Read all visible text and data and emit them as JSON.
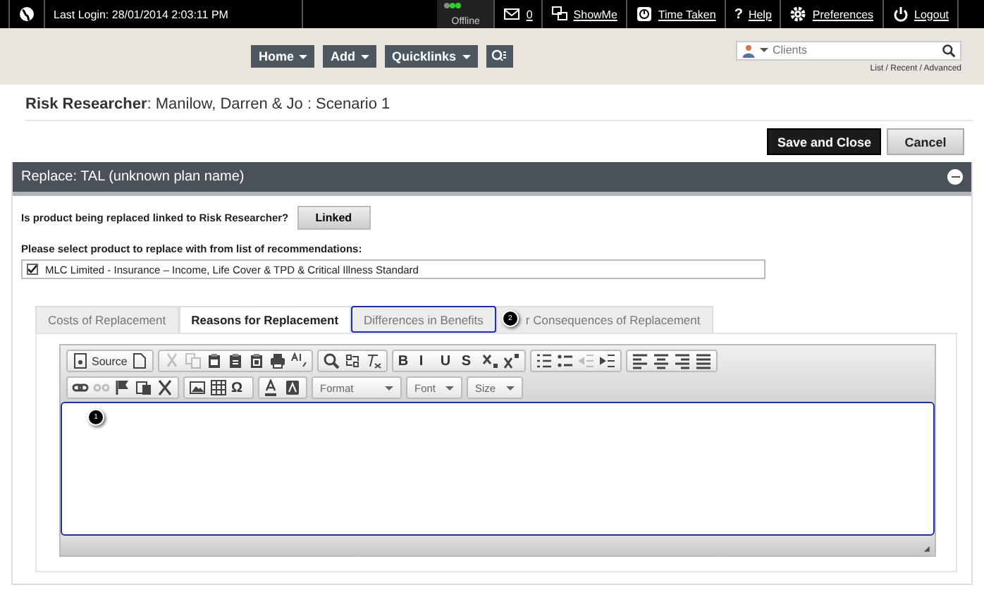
{
  "top_bar": {
    "last_login": "Last Login: 28/01/2014 2:03:11 PM",
    "status": "Offline",
    "items": [
      {
        "kind": "mail",
        "label": "0"
      },
      {
        "kind": "showme",
        "label": "ShowMe"
      },
      {
        "kind": "timer",
        "label": "Time Taken"
      },
      {
        "kind": "help",
        "glyph": "?",
        "label": "Help"
      },
      {
        "kind": "gear",
        "label": "Preferences"
      },
      {
        "kind": "power",
        "label": "Logout"
      }
    ]
  },
  "nav": {
    "menus": [
      {
        "label": "Home"
      },
      {
        "label": "Add"
      },
      {
        "label": "Quicklinks"
      }
    ]
  },
  "client_search": {
    "placeholder": "Clients",
    "links": "List / Recent / Advanced"
  },
  "page_title": "**Risk Researcher**: Manilow, Darren & Jo : Scenario 1",
  "actions": [
    {
      "label": "Save and Close",
      "kind": "primary"
    },
    {
      "label": "Cancel",
      "kind": "secondary"
    }
  ],
  "section": {
    "title": "Replace: TAL (unknown plan name)",
    "expanded": true,
    "question": "Is product being replaced linked to Risk Researcher?",
    "linked_button": "Linked",
    "select_label": "Please select product to replace with from list of recommendations:",
    "recommendations": [
      {
        "label": "MLC Limited - Insurance – Income, Life Cover & TPD & Critical Illness Standard",
        "checked": true
      }
    ],
    "tabs": [
      {
        "label": "Costs of Replacement",
        "selected": false,
        "highlighted": false
      },
      {
        "label": "Reasons for Replacement",
        "selected": true,
        "highlighted": false
      },
      {
        "label": "Differences in Benefits",
        "selected": false,
        "highlighted": true
      },
      {
        "label": "r Consequences of Replacement",
        "selected": false,
        "highlighted": false,
        "callout": "2"
      }
    ],
    "editor": {
      "editor_callout": "1",
      "toolbar": [
        [
          [
            {
              "kind": "icon",
              "label": "Source",
              "disabled": false
            },
            {
              "kind": "icon",
              "disabled": false
            }
          ],
          [
            {
              "kind": "icon",
              "disabled": true
            },
            {
              "kind": "icon",
              "disabled": true
            },
            {
              "kind": "icon",
              "disabled": false
            },
            {
              "kind": "icon",
              "disabled": false
            },
            {
              "kind": "icon",
              "disabled": false
            },
            {
              "kind": "icon",
              "disabled": false
            },
            {
              "kind": "icon",
              "disabled": false
            }
          ],
          [
            {
              "kind": "icon",
              "disabled": false
            },
            {
              "kind": "icon",
              "disabled": false
            },
            {
              "kind": "icon",
              "disabled": false
            }
          ],
          [
            {
              "kind": "glyph",
              "label": "B",
              "disabled": false
            },
            {
              "kind": "glyph",
              "label": "I",
              "disabled": false
            },
            {
              "kind": "glyph",
              "label": "U",
              "disabled": false
            },
            {
              "kind": "glyph",
              "label": "S",
              "disabled": false
            },
            {
              "kind": "icon",
              "disabled": false
            },
            {
              "kind": "icon",
              "disabled": false
            }
          ],
          [
            {
              "kind": "icon",
              "disabled": false
            },
            {
              "kind": "icon",
              "disabled": false
            },
            {
              "kind": "icon",
              "disabled": true
            },
            {
              "kind": "icon",
              "disabled": false
            }
          ],
          [
            {
              "kind": "icon",
              "disabled": false
            },
            {
              "kind": "icon",
              "disabled": false
            },
            {
              "kind": "icon",
              "disabled": false
            },
            {
              "kind": "icon",
              "disabled": false
            }
          ]
        ],
        [
          [
            {
              "kind": "icon",
              "disabled": false
            },
            {
              "kind": "icon",
              "disabled": true
            },
            {
              "kind": "icon",
              "disabled": false
            },
            {
              "kind": "icon",
              "disabled": false
            },
            {
              "kind": "icon",
              "disabled": false
            }
          ],
          [
            {
              "kind": "icon",
              "disabled": false
            },
            {
              "kind": "icon",
              "disabled": false
            },
            {
              "kind": "glyph",
              "label": "Ω",
              "disabled": false
            }
          ],
          [
            {
              "kind": "icon",
              "disabled": false
            },
            {
              "kind": "icon",
              "disabled": false
            }
          ],
          [
            {
              "kind": "combo",
              "label": "Format",
              "disabled": false
            }
          ],
          [
            {
              "kind": "combo",
              "label": "Font",
              "disabled": false
            }
          ],
          [
            {
              "kind": "combo",
              "label": "Size",
              "disabled": false
            }
          ]
        ]
      ]
    }
  }
}
